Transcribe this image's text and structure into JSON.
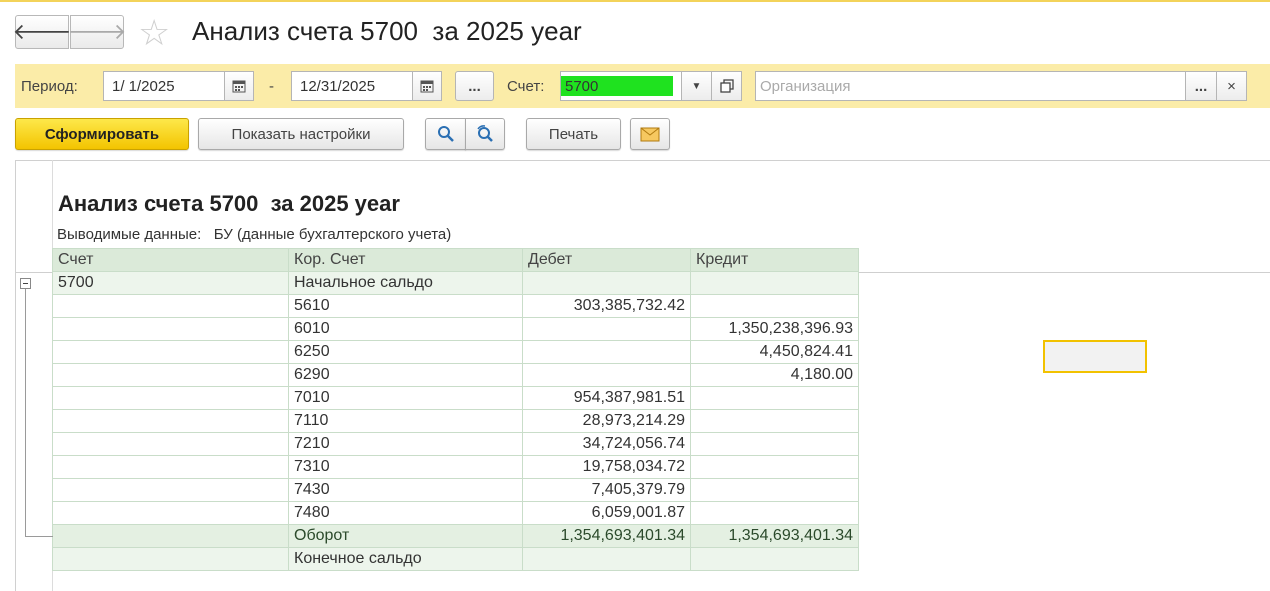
{
  "header": {
    "back_icon": "arrow-left-icon",
    "forward_icon": "arrow-right-icon",
    "favorite_icon": "star-icon",
    "title": "Анализ счета 5700  за 2025 year"
  },
  "filters": {
    "period_label": "Период:",
    "date_from": "1/ 1/2025",
    "dash": "-",
    "date_to": "12/31/2025",
    "period_more": "...",
    "account_label": "Счет:",
    "account_value": "5700",
    "org_placeholder": "Организация",
    "org_more": "...",
    "org_clear": "×",
    "highlight_color": "#1fe21f"
  },
  "toolbar": {
    "generate": "Сформировать",
    "show_settings": "Показать настройки",
    "print": "Печать"
  },
  "report": {
    "title": "Анализ счета 5700  за 2025 year",
    "subtitle": "Выводимые данные:   БУ (данные бухгалтерского учета)",
    "columns": [
      "Счет",
      "Кор. Счет",
      "Дебет",
      "Кредит"
    ],
    "group_account": "5700",
    "opening_label": "Начальное сальдо",
    "rows": [
      {
        "acc": "5610",
        "debit": "303,385,732.42",
        "credit": ""
      },
      {
        "acc": "6010",
        "debit": "",
        "credit": "1,350,238,396.93"
      },
      {
        "acc": "6250",
        "debit": "",
        "credit": "4,450,824.41"
      },
      {
        "acc": "6290",
        "debit": "",
        "credit": "4,180.00"
      },
      {
        "acc": "7010",
        "debit": "954,387,981.51",
        "credit": ""
      },
      {
        "acc": "7110",
        "debit": "28,973,214.29",
        "credit": ""
      },
      {
        "acc": "7210",
        "debit": "34,724,056.74",
        "credit": ""
      },
      {
        "acc": "7310",
        "debit": "19,758,034.72",
        "credit": ""
      },
      {
        "acc": "7430",
        "debit": "7,405,379.79",
        "credit": ""
      },
      {
        "acc": "7480",
        "debit": "6,059,001.87",
        "credit": ""
      }
    ],
    "turnover_label": "Оборот",
    "turnover_debit": "1,354,693,401.34",
    "turnover_credit": "1,354,693,401.34",
    "closing_label": "Конечное сальдо"
  }
}
